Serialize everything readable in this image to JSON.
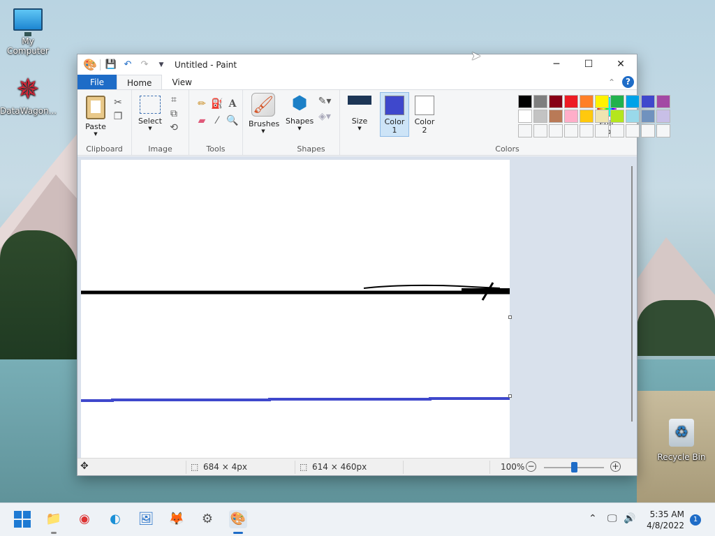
{
  "desktop": {
    "icons": [
      {
        "label": "My Computer",
        "icon": "monitor-icon"
      },
      {
        "label": "DataWagon...",
        "icon": "star-logo-icon"
      },
      {
        "label": "Recycle Bin",
        "icon": "recycle-bin-icon"
      }
    ]
  },
  "window": {
    "title": "Untitled - Paint",
    "controls": {
      "minimize": "─",
      "maximize": "☐",
      "close": "✕"
    }
  },
  "menu": {
    "file": "File",
    "tabs": [
      "Home",
      "View"
    ],
    "active_tab": "Home",
    "help": "?"
  },
  "ribbon": {
    "groups": {
      "clipboard": "Clipboard",
      "image": "Image",
      "tools": "Tools",
      "shapes": "Shapes",
      "colors": "Colors"
    },
    "buttons": {
      "paste": "Paste",
      "select": "Select",
      "brushes": "Brushes",
      "shapes": "Shapes",
      "size": "Size",
      "color1": "Color 1",
      "color2": "Color 2",
      "edit_colors": "Edit colors"
    },
    "color1": "#3f48cc",
    "color2": "#ffffff",
    "palette_row1": [
      "#000000",
      "#7f7f7f",
      "#880015",
      "#ed1c24",
      "#ff7f27",
      "#fff200",
      "#22b14c",
      "#00a2e8",
      "#3f48cc",
      "#a349a4"
    ],
    "palette_row2": [
      "#ffffff",
      "#c3c3c3",
      "#b97a57",
      "#ffaec9",
      "#ffc90e",
      "#efe4b0",
      "#b5e61d",
      "#99d9ea",
      "#7092be",
      "#c8bfe7"
    ],
    "palette_row3": [
      "#f5f6f7",
      "#f5f6f7",
      "#f5f6f7",
      "#f5f6f7",
      "#f5f6f7",
      "#f5f6f7",
      "#f5f6f7",
      "#f5f6f7",
      "#f5f6f7",
      "#f5f6f7"
    ]
  },
  "status": {
    "selection_size": "684 × 4px",
    "canvas_size": "614 × 460px",
    "zoom": "100%",
    "zoom_level": 0.5
  },
  "taskbar": {
    "time": "5:35 AM",
    "date": "4/8/2022",
    "notifications": "1"
  }
}
